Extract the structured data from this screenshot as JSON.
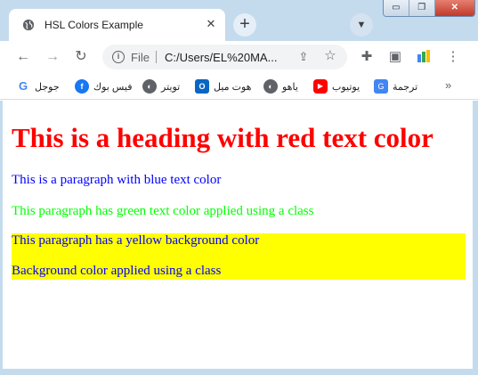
{
  "browser": {
    "tab": {
      "title": "HSL Colors Example",
      "close": "✕"
    },
    "new_tab": "+",
    "window_controls": {
      "minimize": "▭",
      "restore": "❐",
      "close": "✕"
    }
  },
  "toolbar": {
    "omnibox": {
      "scheme": "File",
      "url": "C:/Users/EL%20MA..."
    }
  },
  "bookmarks": [
    {
      "label": "جوجل",
      "icon": "google-icon",
      "color": "#4285f4"
    },
    {
      "label": "فيس بوك",
      "icon": "facebook-icon",
      "color": "#1877f2"
    },
    {
      "label": "تويتر",
      "icon": "globe-icon",
      "color": "#5f6368"
    },
    {
      "label": "هوت ميل",
      "icon": "outlook-icon",
      "color": "#0a66c2"
    },
    {
      "label": "ياهو",
      "icon": "globe-icon",
      "color": "#5f6368"
    },
    {
      "label": "يوتيوب",
      "icon": "youtube-icon",
      "color": "#ff0000"
    },
    {
      "label": "ترجمة",
      "icon": "translate-icon",
      "color": "#4285f4"
    }
  ],
  "page": {
    "heading": "This is a heading with red text color",
    "para_blue": "This is a paragraph with blue text color",
    "para_green": "This paragraph has green text color applied using a class",
    "para_yellow": "This paragraph has a yellow background color",
    "para_class_bg": "Background color applied using a class"
  },
  "colors": {
    "heading": "#ff0000",
    "blue": "#0000ff",
    "green": "#00ff00",
    "yellow_bg": "#ffff00",
    "chrome_frame": "#c4dbee"
  }
}
